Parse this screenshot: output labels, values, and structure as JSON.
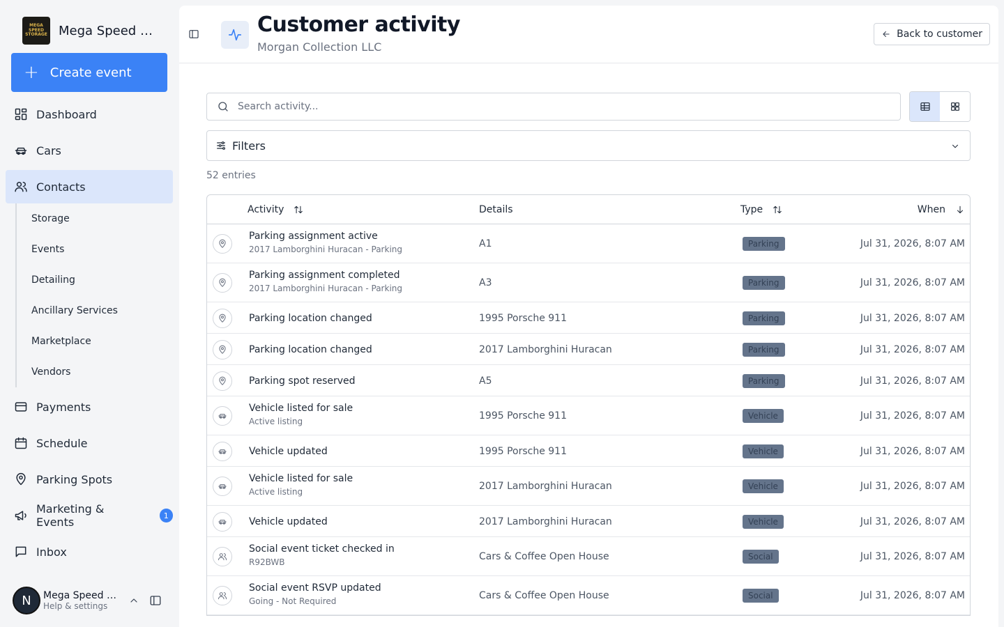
{
  "sidebar": {
    "brand_name": "Mega Speed St...",
    "logo_text": "MEGA SPEED STORAGE",
    "create_label": "Create event",
    "nav": [
      {
        "label": "Dashboard",
        "icon": "dashboard-icon"
      },
      {
        "label": "Cars",
        "icon": "car-icon"
      },
      {
        "label": "Contacts",
        "icon": "users-icon",
        "active": true
      }
    ],
    "sub_items": [
      "Storage",
      "Events",
      "Detailing",
      "Ancillary Services",
      "Marketplace",
      "Vendors"
    ],
    "nav_bottom": [
      {
        "label": "Payments",
        "icon": "credit-card-icon"
      },
      {
        "label": "Schedule",
        "icon": "calendar-icon"
      },
      {
        "label": "Parking Spots",
        "icon": "map-pin-icon"
      },
      {
        "label": "Marketing & Events",
        "icon": "megaphone-icon",
        "badge": "1"
      },
      {
        "label": "Inbox",
        "icon": "message-icon"
      }
    ],
    "user": {
      "initial": "N",
      "name": "Mega Speed St...",
      "sub": "Help & settings"
    }
  },
  "header": {
    "title": "Customer activity",
    "subtitle": "Morgan Collection LLC",
    "back_label": "Back to customer"
  },
  "search": {
    "placeholder": "Search activity..."
  },
  "filters": {
    "label": "Filters"
  },
  "entries": "52 entries",
  "table": {
    "columns": {
      "activity": "Activity",
      "details": "Details",
      "type": "Type",
      "when": "When"
    },
    "rows": [
      {
        "icon": "map-pin-icon",
        "title": "Parking assignment active",
        "sub": "2017 Lamborghini Huracan - Parking",
        "details": "A1",
        "type": "Parking",
        "when": "Jul 31, 2026, 8:07 AM"
      },
      {
        "icon": "map-pin-icon",
        "title": "Parking assignment completed",
        "sub": "2017 Lamborghini Huracan - Parking",
        "details": "A3",
        "type": "Parking",
        "when": "Jul 31, 2026, 8:07 AM"
      },
      {
        "icon": "map-pin-icon",
        "title": "Parking location changed",
        "sub": "",
        "details": "1995 Porsche 911",
        "type": "Parking",
        "when": "Jul 31, 2026, 8:07 AM"
      },
      {
        "icon": "map-pin-icon",
        "title": "Parking location changed",
        "sub": "",
        "details": "2017 Lamborghini Huracan",
        "type": "Parking",
        "when": "Jul 31, 2026, 8:07 AM"
      },
      {
        "icon": "map-pin-icon",
        "title": "Parking spot reserved",
        "sub": "",
        "details": "A5",
        "type": "Parking",
        "when": "Jul 31, 2026, 8:07 AM"
      },
      {
        "icon": "car-icon",
        "title": "Vehicle listed for sale",
        "sub": "Active listing",
        "details": "1995 Porsche 911",
        "type": "Vehicle",
        "when": "Jul 31, 2026, 8:07 AM"
      },
      {
        "icon": "car-icon",
        "title": "Vehicle updated",
        "sub": "",
        "details": "1995 Porsche 911",
        "type": "Vehicle",
        "when": "Jul 31, 2026, 8:07 AM"
      },
      {
        "icon": "car-icon",
        "title": "Vehicle listed for sale",
        "sub": "Active listing",
        "details": "2017 Lamborghini Huracan",
        "type": "Vehicle",
        "when": "Jul 31, 2026, 8:07 AM"
      },
      {
        "icon": "car-icon",
        "title": "Vehicle updated",
        "sub": "",
        "details": "2017 Lamborghini Huracan",
        "type": "Vehicle",
        "when": "Jul 31, 2026, 8:07 AM"
      },
      {
        "icon": "users-icon",
        "title": "Social event ticket checked in",
        "sub": "R92BWB",
        "details": "Cars & Coffee Open House",
        "type": "Social",
        "when": "Jul 31, 2026, 8:07 AM"
      },
      {
        "icon": "users-icon",
        "title": "Social event RSVP updated",
        "sub": "Going - Not Required",
        "details": "Cars & Coffee Open House",
        "type": "Social",
        "when": "Jul 31, 2026, 8:07 AM"
      }
    ]
  },
  "colors": {
    "accent": "#3b82f6",
    "active_bg": "#dbe6fb",
    "badge_bg": "#64748b"
  }
}
